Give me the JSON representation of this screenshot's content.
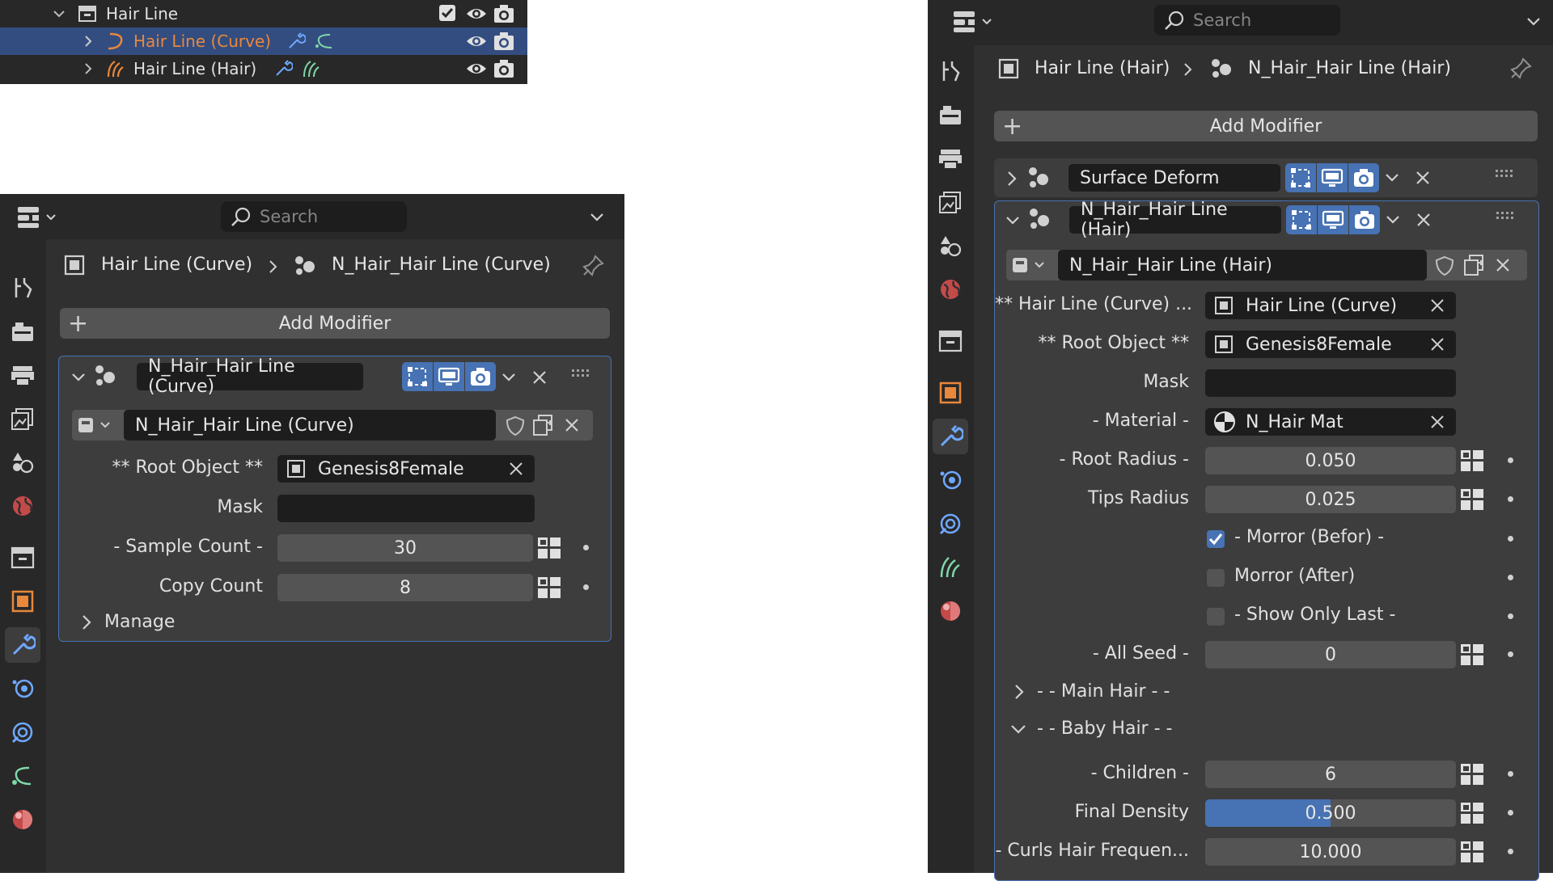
{
  "outliner": {
    "collection": "Hair Line",
    "curve_item": "Hair Line (Curve)",
    "hair_item": "Hair Line (Hair)"
  },
  "left": {
    "search_placeholder": "Search",
    "breadcrumb": {
      "object": "Hair Line (Curve)",
      "modifier": "N_Hair_Hair Line (Curve)"
    },
    "add_modifier": "Add Modifier",
    "modifier": {
      "name": "N_Hair_Hair Line (Curve)",
      "node_group": "N_Hair_Hair Line (Curve)",
      "root_object_label": "** Root Object **",
      "root_object_value": "Genesis8Female",
      "mask_label": "Mask",
      "mask_value": "",
      "sample_count_label": "- Sample Count -",
      "sample_count_value": "30",
      "copy_count_label": "Copy Count",
      "copy_count_value": "8",
      "manage_label": "Manage"
    }
  },
  "right": {
    "search_placeholder": "Search",
    "breadcrumb": {
      "object": "Hair Line (Hair)",
      "modifier": "N_Hair_Hair Line (Hair)"
    },
    "add_modifier": "Add Modifier",
    "surface_deform": "Surface Deform",
    "modifier": {
      "name": "N_Hair_Hair Line (Hair)",
      "node_group": "N_Hair_Hair Line (Hair)",
      "hair_line_label": "** Hair Line (Curve) ...",
      "hair_line_value": "Hair Line (Curve)",
      "root_object_label": "** Root Object **",
      "root_object_value": "Genesis8Female",
      "mask_label": "Mask",
      "mask_value": "",
      "material_label": "- Material -",
      "material_value": "N_Hair Mat",
      "root_radius_label": "- Root Radius -",
      "root_radius_value": "0.050",
      "tips_radius_label": "Tips Radius",
      "tips_radius_value": "0.025",
      "morror_befor_label": "- Morror (Befor) -",
      "morror_befor_checked": true,
      "morror_after_label": "Morror (After)",
      "morror_after_checked": false,
      "show_only_last_label": "- Show Only Last -",
      "show_only_last_checked": false,
      "all_seed_label": "- All Seed -",
      "all_seed_value": "0",
      "main_hair_label": "- - Main Hair - -",
      "baby_hair_label": "- - Baby Hair - -",
      "children_label": "- Children -",
      "children_value": "6",
      "final_density_label": "Final Density",
      "final_density_value": "0.500",
      "final_density_fraction": 0.5,
      "curls_label": "- Curls Hair Frequen...",
      "curls_value": "10.000"
    }
  },
  "colors": {
    "accent": "#4772b3",
    "selected_row": "#334d80",
    "curve_text": "#e9883b",
    "panel": "#303030"
  }
}
